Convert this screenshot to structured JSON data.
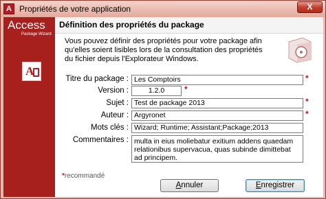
{
  "window": {
    "title": "Propriétés de votre application",
    "close_label": "X"
  },
  "sidebar": {
    "brand": "Access",
    "subtitle": "Package Wizard",
    "logo_letter": "A"
  },
  "panel": {
    "title": "Définition des propriétés du package",
    "description": "Vous pouvez définir des propriétés pour votre package afin qu'elles soient lisibles lors de la consultation des propriétés du fichier depuis l'Explorateur Windows."
  },
  "form": {
    "titre": {
      "label": "Titre du package :",
      "value": "Les Comptoirs"
    },
    "version": {
      "label": "Version :",
      "value": "1.2.0"
    },
    "sujet": {
      "label": "Sujet :",
      "value": "Test de package 2013"
    },
    "auteur": {
      "label": "Auteur :",
      "value": "Argyronet"
    },
    "motscles": {
      "label": "Mots clés :",
      "value": "Wizard; Runtime; Assistant;Package;2013"
    },
    "commentaires": {
      "label": "Commentaires :",
      "value": "multa in eius moliebatur exitium addens quaedam relationibus supervacua, quas subinde dimittebat ad principem."
    },
    "required_mark": "*"
  },
  "legend": {
    "mark": "*",
    "text": "recommandé"
  },
  "buttons": {
    "cancel": {
      "underline": "A",
      "rest": "nnuler"
    },
    "register": {
      "underline": "E",
      "rest": "nregistrer"
    }
  },
  "colors": {
    "sidebar": "#a8201e",
    "accent_required": "#d01010",
    "titlebar": "#e8b8ad"
  },
  "icons": {
    "app": "access-app-icon",
    "product": "software-box-icon"
  }
}
